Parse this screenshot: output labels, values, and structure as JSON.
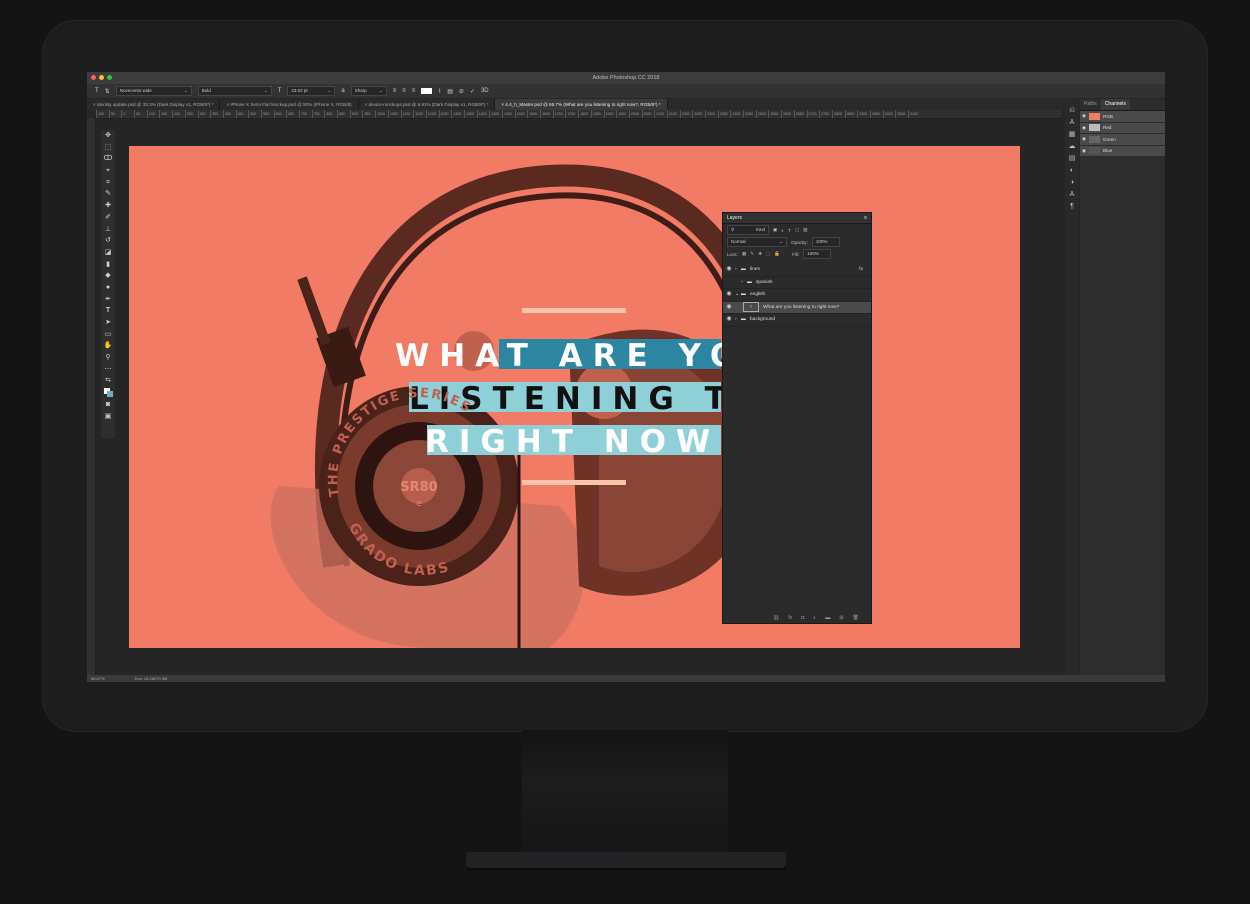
{
  "window": {
    "title": "Adobe Photoshop CC 2018",
    "traffic_lights": [
      "#ff5f57",
      "#febc2e",
      "#28c840"
    ]
  },
  "options_bar": {
    "font_family": "Novecento wide",
    "font_style": "Bold",
    "font_size": "23.02 pt",
    "antialias": "Sharp",
    "icons": [
      "type-tool-icon",
      "orientation-icon",
      "font-size-icon",
      "antialias-icon",
      "align-icons",
      "color-swatch",
      "warp-icon",
      "panels-icon",
      "cancel-icon",
      "commit-icon",
      "3d-icon"
    ],
    "mode_3d_label": "3D"
  },
  "tabs": [
    {
      "label": "identity update.psd @ 33.3% (Dark Display x1, RGB/8*) *",
      "active": false
    },
    {
      "label": "iPhone X Semi Flat Mockup.psd @ 50% (iPhone X, RGB/8)",
      "active": false
    },
    {
      "label": "device-mockups.psd @ 6.91% (Dark Display x1, RGB/8*) *",
      "active": false
    },
    {
      "label": "4.4_h_Master.psd @ 66.7% (What are you listening to right now?, RGB/8*) *",
      "active": true
    }
  ],
  "ruler_ticks": [
    "100",
    "50",
    "0",
    "50",
    "100",
    "150",
    "200",
    "250",
    "300",
    "350",
    "400",
    "450",
    "500",
    "550",
    "600",
    "650",
    "700",
    "750",
    "800",
    "850",
    "900",
    "950",
    "1000",
    "1050",
    "1100",
    "1150",
    "1200",
    "1250",
    "1300",
    "1350",
    "1400",
    "1450",
    "1500",
    "1550",
    "1600",
    "1650",
    "1700",
    "1750",
    "1800",
    "1850",
    "1900",
    "1950",
    "2000",
    "2050",
    "2100",
    "2150",
    "2200",
    "2250",
    "2300",
    "2350",
    "2400",
    "2450",
    "2500",
    "2550",
    "2600",
    "2650",
    "2700",
    "2750",
    "2800",
    "2850",
    "2900",
    "2950",
    "3000",
    "3050",
    "3100"
  ],
  "canvas": {
    "background": "#f17b64",
    "headline_lines": [
      "WHAT ARE YO",
      "LISTENING TO",
      "RIGHT NOW?"
    ],
    "headphone_text": {
      "series": "THE PRESTIGE SERIES",
      "brand": "GRADO LABS",
      "model": "SR80",
      "model_sub": "e"
    }
  },
  "layers_panel": {
    "title": "Layers",
    "search_placeholder": "Kind",
    "blend_mode": "Normal",
    "opacity_label": "Opacity:",
    "opacity_value": "100%",
    "lock_label": "Lock:",
    "fill_label": "Fill:",
    "fill_value": "100%",
    "layers": [
      {
        "name": "lines",
        "type": "group",
        "indent": 0,
        "visible": true,
        "fx": "fx"
      },
      {
        "name": "spanish",
        "type": "group",
        "indent": 1,
        "visible": false
      },
      {
        "name": "english",
        "type": "group",
        "indent": 0,
        "visible": true,
        "expanded": true
      },
      {
        "name": "What are you listening to right now?",
        "type": "text",
        "indent": 2,
        "visible": true,
        "selected": true
      },
      {
        "name": "background",
        "type": "group",
        "indent": 0,
        "visible": true
      }
    ]
  },
  "channels_panel": {
    "tabs": [
      "Paths",
      "Channels"
    ],
    "active_tab": "Channels",
    "channels": [
      "RGB",
      "Red",
      "Green",
      "Blue"
    ]
  },
  "status_bar": {
    "zoom": "66.67%",
    "doc": "Doc: 16.2M/70.3M"
  }
}
